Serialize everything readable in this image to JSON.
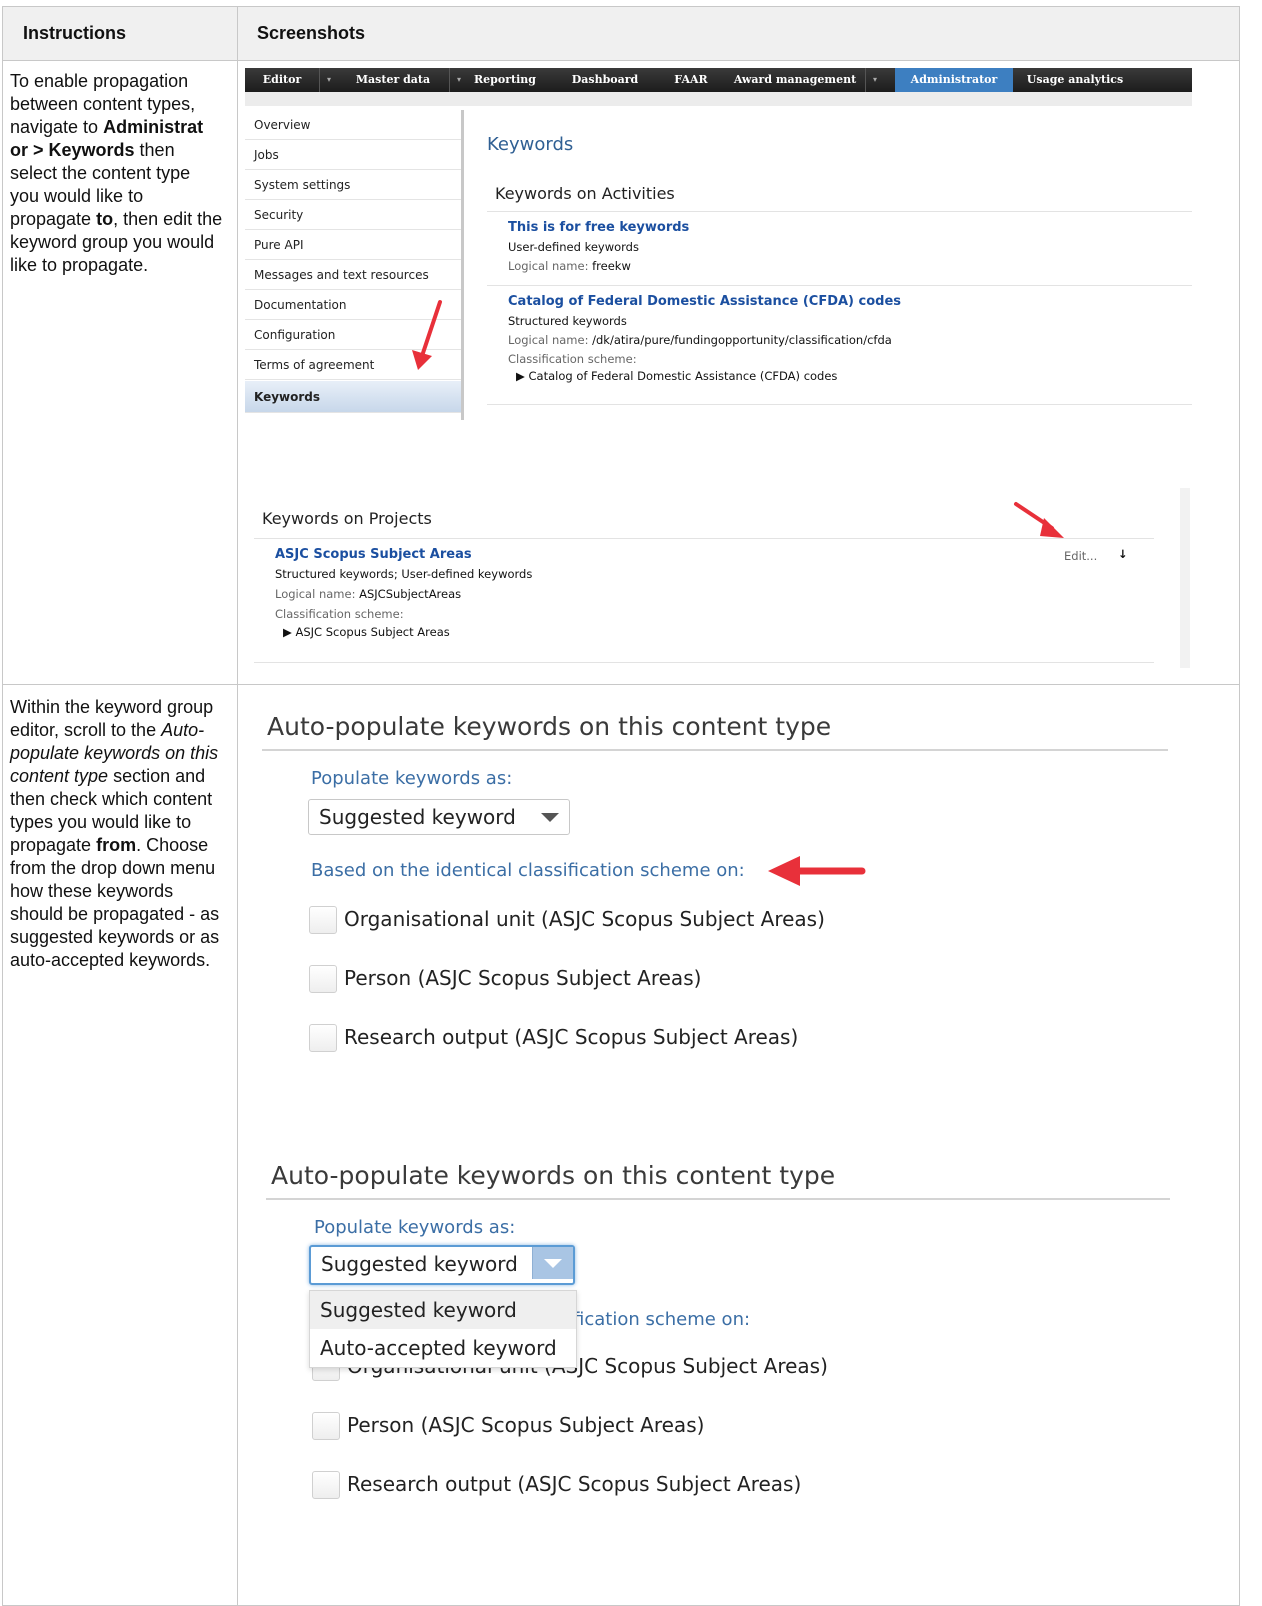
{
  "table": {
    "col_instructions": "Instructions",
    "col_screenshots": "Screenshots"
  },
  "row1": {
    "instruction": {
      "t1": "To enable propagation between content types, navigate to ",
      "b1": "Administrat or > Keywords",
      "t2": " then select the content type you would like to propagate ",
      "b2": "to",
      "t3": ", then edit the keyword group you would like to propagate."
    },
    "navbar": [
      {
        "label": "Editor",
        "caret": true
      },
      {
        "label": "Master data",
        "caret": true
      },
      {
        "label": "Reporting",
        "caret": false
      },
      {
        "label": "Dashboard",
        "caret": false
      },
      {
        "label": "FAAR",
        "caret": false
      },
      {
        "label": "Award management",
        "caret": true
      },
      {
        "label": "Administrator",
        "caret": false,
        "active": true
      },
      {
        "label": "Usage analytics",
        "caret": false
      }
    ],
    "caret_glyph": "▾",
    "sidebar": [
      "Overview",
      "Jobs",
      "System settings",
      "Security",
      "Pure API",
      "Messages and text resources",
      "Documentation",
      "Configuration",
      "Terms of agreement",
      "Keywords"
    ],
    "keywords_title": "Keywords",
    "activities": {
      "heading": "Keywords on Activities",
      "group1": {
        "title": "This is for free keywords",
        "type": "User-defined keywords",
        "logical_label": "Logical name:",
        "logical_value": "freekw"
      },
      "group2": {
        "title": "Catalog of Federal Domestic Assistance (CFDA) codes",
        "type": "Structured keywords",
        "logical_label": "Logical name:",
        "logical_value": "/dk/atira/pure/fundingopportunity/classification/cfda",
        "scheme_label": "Classification scheme:",
        "scheme_value": "▶  Catalog of Federal Domestic Assistance (CFDA) codes"
      }
    },
    "projects": {
      "heading": "Keywords on Projects",
      "title": "ASJC Scopus Subject Areas",
      "type": "Structured keywords; User-defined keywords",
      "logical_label": "Logical name:",
      "logical_value": "ASJCSubjectAreas",
      "scheme_label": "Classification scheme:",
      "scheme_value": "▶  ASJC Scopus Subject Areas",
      "edit": "Edit...",
      "arrow_glyph": "↓"
    }
  },
  "row2": {
    "instruction": {
      "t1": "Within the keyword group editor, scroll to the ",
      "i1": "Auto-populate keywords on this content type",
      "t2": " section and then check which content types you would like to propagate ",
      "b1": "from",
      "t3": ". Choose from the drop down menu how these keywords should be propagated - as suggested keywords or as auto-accepted keywords."
    },
    "panel1": {
      "title": "Auto-populate keywords on this content type",
      "populate_label": "Populate keywords as:",
      "selected": "Suggested keyword",
      "based_on": "Based on the identical classification scheme on:",
      "options": [
        "Organisational unit (ASJC Scopus Subject Areas)",
        "Person (ASJC Scopus Subject Areas)",
        "Research output (ASJC Scopus Subject Areas)"
      ]
    },
    "panel2": {
      "title": "Auto-populate keywords on this content type",
      "populate_label": "Populate keywords as:",
      "selected": "Suggested keyword",
      "based_on_partial": "fication scheme on:",
      "dropdown": [
        "Suggested keyword",
        "Auto-accepted keyword"
      ],
      "options_partial": "Organisational unit (ASJC Scopus Subject Areas)",
      "options": [
        "Person (ASJC Scopus Subject Areas)",
        "Research output (ASJC Scopus Subject Areas)"
      ]
    }
  },
  "colors": {
    "nav_active": "#3d7fc1",
    "link": "#1b4fa0",
    "label_blue": "#3b6ea5",
    "annotation_arrow": "#e8303a"
  }
}
